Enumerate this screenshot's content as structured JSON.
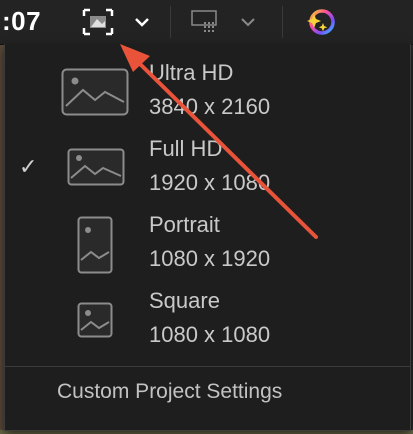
{
  "toolbar": {
    "timecode": ":07",
    "resolution_icon": "resolution-picker-icon",
    "layout_icon": "viewer-layout-icon",
    "effects_icon": "magic-sparkle-icon"
  },
  "menu": {
    "items": [
      {
        "name": "Ultra HD",
        "dims": "3840 x 2160",
        "selected": false,
        "icon": "landscape-image-icon"
      },
      {
        "name": "Full HD",
        "dims": "1920 x 1080",
        "selected": true,
        "icon": "landscape-image-icon"
      },
      {
        "name": "Portrait",
        "dims": "1080 x 1920",
        "selected": false,
        "icon": "portrait-image-icon"
      },
      {
        "name": "Square",
        "dims": "1080 x 1080",
        "selected": false,
        "icon": "square-image-icon"
      }
    ],
    "check_glyph": "✓",
    "custom_label": "Custom Project Settings"
  },
  "colors": {
    "annotation_arrow": "#e8533a",
    "menu_bg": "#1e1e1e",
    "text": "#c9c9c9"
  }
}
